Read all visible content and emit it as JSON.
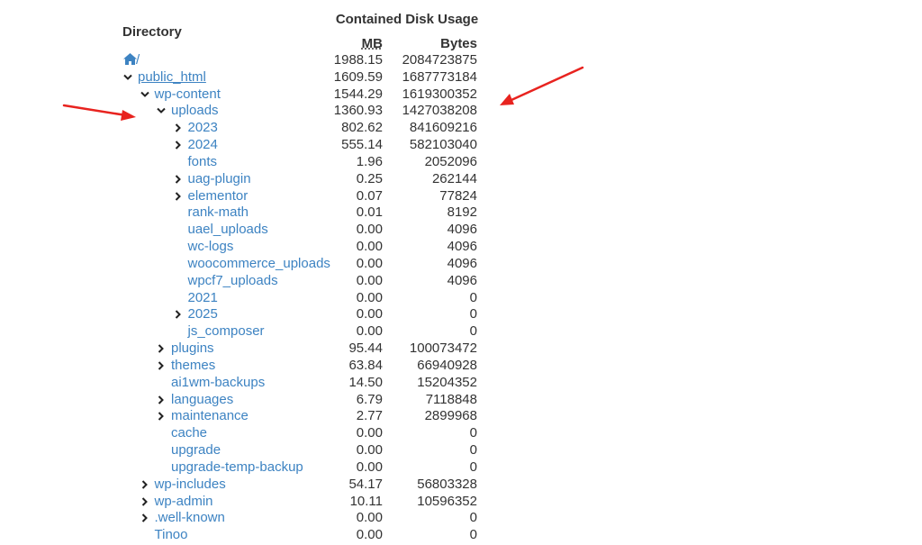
{
  "headers": {
    "directory": "Directory",
    "usage": "Contained Disk Usage",
    "mb": "MB",
    "bytes": "Bytes"
  },
  "rows": [
    {
      "name": "/",
      "mb": "1988.15",
      "bytes": "2084723875",
      "depth": 0,
      "toggle": "none",
      "home": true
    },
    {
      "name": "public_html",
      "mb": "1609.59",
      "bytes": "1687773184",
      "depth": 0,
      "toggle": "open",
      "underline": true
    },
    {
      "name": "wp-content",
      "mb": "1544.29",
      "bytes": "1619300352",
      "depth": 1,
      "toggle": "open"
    },
    {
      "name": "uploads",
      "mb": "1360.93",
      "bytes": "1427038208",
      "depth": 2,
      "toggle": "open"
    },
    {
      "name": "2023",
      "mb": "802.62",
      "bytes": "841609216",
      "depth": 3,
      "toggle": "closed"
    },
    {
      "name": "2024",
      "mb": "555.14",
      "bytes": "582103040",
      "depth": 3,
      "toggle": "closed"
    },
    {
      "name": "fonts",
      "mb": "1.96",
      "bytes": "2052096",
      "depth": 3,
      "toggle": "none"
    },
    {
      "name": "uag-plugin",
      "mb": "0.25",
      "bytes": "262144",
      "depth": 3,
      "toggle": "closed"
    },
    {
      "name": "elementor",
      "mb": "0.07",
      "bytes": "77824",
      "depth": 3,
      "toggle": "closed"
    },
    {
      "name": "rank-math",
      "mb": "0.01",
      "bytes": "8192",
      "depth": 3,
      "toggle": "none"
    },
    {
      "name": "uael_uploads",
      "mb": "0.00",
      "bytes": "4096",
      "depth": 3,
      "toggle": "none"
    },
    {
      "name": "wc-logs",
      "mb": "0.00",
      "bytes": "4096",
      "depth": 3,
      "toggle": "none"
    },
    {
      "name": "woocommerce_uploads",
      "mb": "0.00",
      "bytes": "4096",
      "depth": 3,
      "toggle": "none"
    },
    {
      "name": "wpcf7_uploads",
      "mb": "0.00",
      "bytes": "4096",
      "depth": 3,
      "toggle": "none"
    },
    {
      "name": "2021",
      "mb": "0.00",
      "bytes": "0",
      "depth": 3,
      "toggle": "none"
    },
    {
      "name": "2025",
      "mb": "0.00",
      "bytes": "0",
      "depth": 3,
      "toggle": "closed"
    },
    {
      "name": "js_composer",
      "mb": "0.00",
      "bytes": "0",
      "depth": 3,
      "toggle": "none"
    },
    {
      "name": "plugins",
      "mb": "95.44",
      "bytes": "100073472",
      "depth": 2,
      "toggle": "closed"
    },
    {
      "name": "themes",
      "mb": "63.84",
      "bytes": "66940928",
      "depth": 2,
      "toggle": "closed"
    },
    {
      "name": "ai1wm-backups",
      "mb": "14.50",
      "bytes": "15204352",
      "depth": 2,
      "toggle": "none"
    },
    {
      "name": "languages",
      "mb": "6.79",
      "bytes": "7118848",
      "depth": 2,
      "toggle": "closed"
    },
    {
      "name": "maintenance",
      "mb": "2.77",
      "bytes": "2899968",
      "depth": 2,
      "toggle": "closed"
    },
    {
      "name": "cache",
      "mb": "0.00",
      "bytes": "0",
      "depth": 2,
      "toggle": "none"
    },
    {
      "name": "upgrade",
      "mb": "0.00",
      "bytes": "0",
      "depth": 2,
      "toggle": "none"
    },
    {
      "name": "upgrade-temp-backup",
      "mb": "0.00",
      "bytes": "0",
      "depth": 2,
      "toggle": "none"
    },
    {
      "name": "wp-includes",
      "mb": "54.17",
      "bytes": "56803328",
      "depth": 1,
      "toggle": "closed"
    },
    {
      "name": "wp-admin",
      "mb": "10.11",
      "bytes": "10596352",
      "depth": 1,
      "toggle": "closed"
    },
    {
      "name": ".well-known",
      "mb": "0.00",
      "bytes": "0",
      "depth": 1,
      "toggle": "closed"
    },
    {
      "name": "Tinoo",
      "mb": "0.00",
      "bytes": "0",
      "depth": 1,
      "toggle": "none"
    }
  ],
  "colors": {
    "link": "#3d83c2",
    "text": "#333333",
    "arrow": "#e8231f"
  }
}
